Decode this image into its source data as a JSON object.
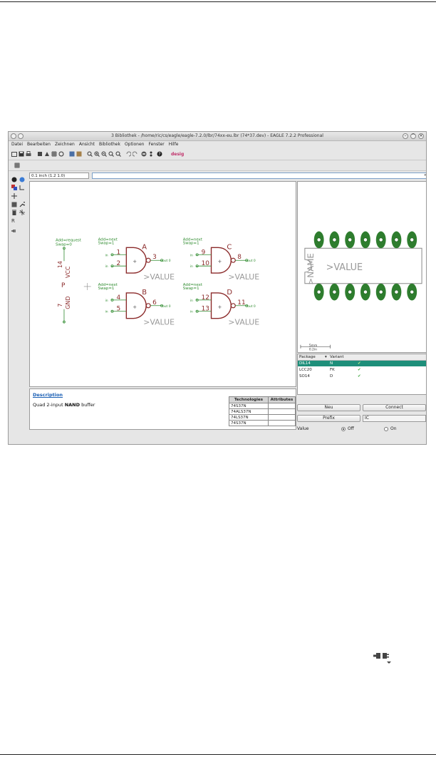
{
  "window": {
    "title": "3 Bibliothek - /home/ric/cs/eagle/eagle-7.2.0/lbr/74xx-eu.lbr (74*37.dev) - EAGLE 7.2.2 Professional"
  },
  "menu": [
    "Datei",
    "Bearbeiten",
    "Zeichnen",
    "Ansicht",
    "Bibliothek",
    "Optionen",
    "Fenster",
    "Hilfe"
  ],
  "coordinates": "0.1 inch (1.2 1.0)",
  "schematic": {
    "gates": [
      {
        "letter": "A",
        "pin_in1": "1",
        "pin_in2": "2",
        "pin_out": "3",
        "add": "Add=next",
        "swap": "Swap=1"
      },
      {
        "letter": "B",
        "pin_in1": "4",
        "pin_in2": "5",
        "pin_out": "6",
        "add": "Add=next",
        "swap": "Swap=1"
      },
      {
        "letter": "C",
        "pin_in1": "9",
        "pin_in2": "10",
        "pin_out": "8",
        "add": "Add=next",
        "swap": "Swap=1"
      },
      {
        "letter": "D",
        "pin_in1": "12",
        "pin_in2": "13",
        "pin_out": "11",
        "add": "Add=next",
        "swap": "Swap=1"
      }
    ],
    "value_text": ">VALUE",
    "in_label": "in",
    "out_label": "out 0",
    "power": {
      "add": "Add=request",
      "swap": "Swap=0",
      "vcc_pin": "14",
      "vcc": "VCC",
      "gnd_pin": "7",
      "gnd": "GND",
      "p": "P"
    }
  },
  "package": {
    "name_text": ">NAME",
    "value_text": ">VALUE",
    "scale": "5mm",
    "scale_sub": "0.2in"
  },
  "description": {
    "title": "Description",
    "text_pre": "Quad 2-input ",
    "text_bold": "NAND",
    "text_post": " buffer"
  },
  "technologies": {
    "header_tech": "Technologies",
    "header_attr": "Attributes",
    "rows": [
      "74S37N",
      "74ALS37N",
      "74LS37N",
      "74S37N"
    ]
  },
  "package_list": {
    "header_package": "Package",
    "header_variant": "Variant",
    "rows": [
      {
        "package": "DIL14",
        "variant": "N",
        "selected": true
      },
      {
        "package": "LCC20",
        "variant": "FK",
        "selected": false
      },
      {
        "package": "SO14",
        "variant": "D",
        "selected": false
      }
    ]
  },
  "buttons": {
    "neu": "Neu",
    "connect": "Connect",
    "prefix": "Prefix",
    "prefix_value": "IC"
  },
  "value_option": {
    "label": "Value",
    "off": "Off",
    "on": "On",
    "selected": "off"
  },
  "colors": {
    "gate": "#8b2a2a",
    "pin": "#2e8b2e",
    "pad": "#2e7d2e",
    "selected": "#1e8f7a"
  },
  "floating_icon": "connect-plugs-icon"
}
